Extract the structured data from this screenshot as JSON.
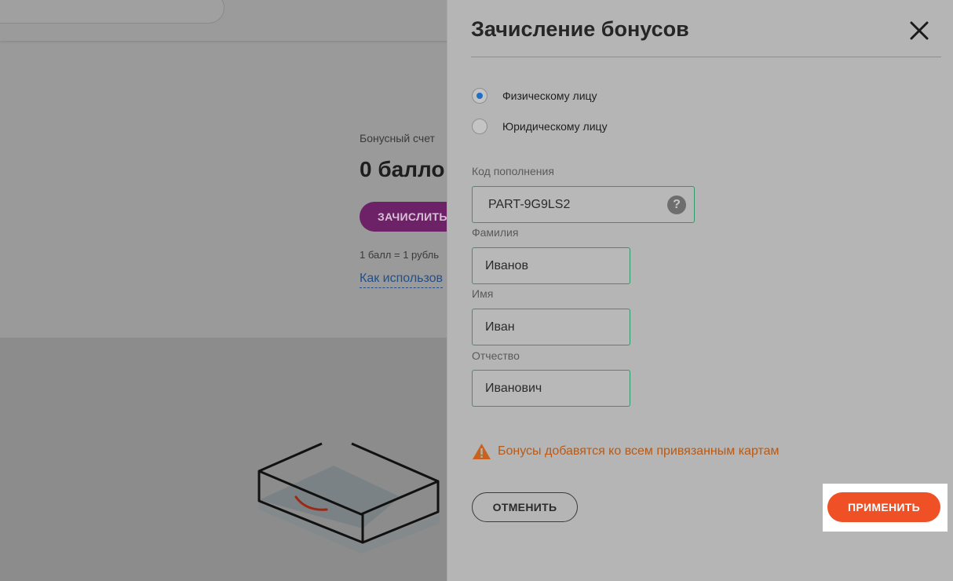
{
  "background": {
    "bonus_label": "Бонусный счет",
    "points": "0 балло",
    "credit_button": "ЗАЧИСЛИТЬ",
    "rate": "1 балл = 1 рубль",
    "how_to_link": "Как использов"
  },
  "panel": {
    "title": "Зачисление бонусов",
    "recipient_options": [
      {
        "label": "Физическому лицу",
        "checked": true
      },
      {
        "label": "Юридическому лицу",
        "checked": false
      }
    ],
    "fields": {
      "code": {
        "label": "Код пополнения",
        "value": "PART-9G9LS2"
      },
      "last_name": {
        "label": "Фамилия",
        "value": "Иванов"
      },
      "first_name": {
        "label": "Имя",
        "value": "Иван"
      },
      "middle_name": {
        "label": "Отчество",
        "value": "Иванович"
      }
    },
    "help_glyph": "?",
    "warning": "Бонусы добавятся ко всем привязанным картам",
    "cancel_label": "ОТМЕНИТЬ",
    "apply_label": "ПРИМЕНИТЬ"
  },
  "colors": {
    "accent_radio": "#1f6fc5",
    "field_border": "#2f9a6a",
    "warning": "#b85a16",
    "apply": "#ef5025",
    "credit_button": "#6d2166"
  }
}
